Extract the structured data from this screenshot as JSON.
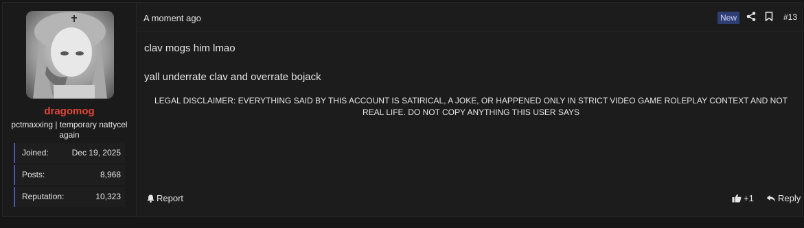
{
  "user": {
    "username": "dragomog",
    "title": "pctmaxxing | temporary nattycel again",
    "avatar_icon": "avatar-image",
    "stats": [
      {
        "label": "Joined:",
        "value": "Dec 19, 2025"
      },
      {
        "label": "Posts:",
        "value": "8,968"
      },
      {
        "label": "Reputation:",
        "value": "10,323"
      }
    ]
  },
  "post": {
    "timestamp": "A moment ago",
    "badge": "New",
    "number": "#13",
    "lines": [
      "clav mogs him lmao",
      "yall underrate clav and overrate bojack"
    ],
    "disclaimer": "LEGAL DISCLAIMER: EVERYTHING SAID BY THIS ACCOUNT IS SATIRICAL, A JOKE, OR HAPPENED ONLY IN STRICT VIDEO GAME ROLEPLAY CONTEXT AND NOT REAL LIFE. DO NOT COPY ANYTHING THIS USER SAYS"
  },
  "actions": {
    "report_label": "Report",
    "like_count": "+1",
    "reply_label": "Reply"
  },
  "colors": {
    "username": "#e2453a",
    "stat_accent": "#4a57b4",
    "badge_bg": "#2e3d72"
  }
}
